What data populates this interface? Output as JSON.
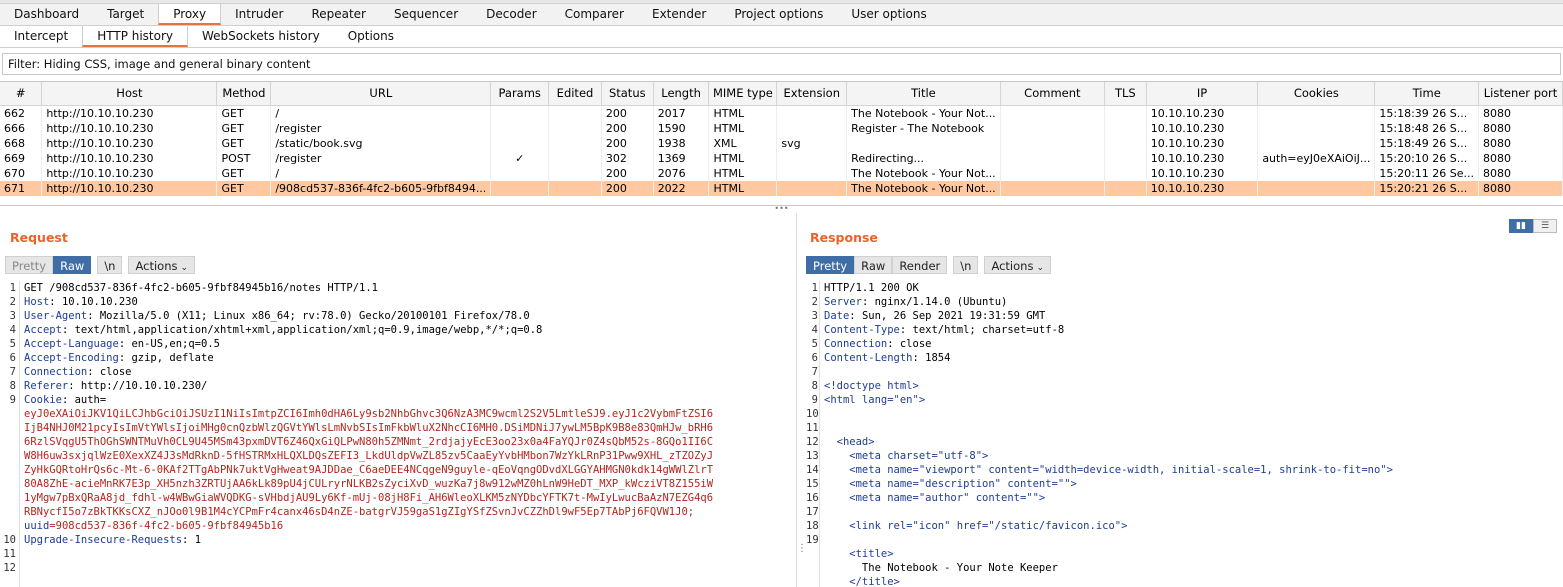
{
  "main_tabs": [
    "Dashboard",
    "Target",
    "Proxy",
    "Intruder",
    "Repeater",
    "Sequencer",
    "Decoder",
    "Comparer",
    "Extender",
    "Project options",
    "User options"
  ],
  "main_tab_active": 2,
  "sub_tabs": [
    "Intercept",
    "HTTP history",
    "WebSockets history",
    "Options"
  ],
  "sub_tab_active": 1,
  "filter_text": "Filter: Hiding CSS, image and general binary content",
  "history": {
    "columns": [
      "#",
      "Host",
      "Method",
      "URL",
      "Params",
      "Edited",
      "Status",
      "Length",
      "MIME type",
      "Extension",
      "Title",
      "Comment",
      "TLS",
      "IP",
      "Cookies",
      "Time",
      "Listener port"
    ],
    "rows": [
      [
        "662",
        "http://10.10.10.230",
        "GET",
        "/",
        "",
        "",
        "200",
        "2017",
        "HTML",
        "",
        "The Notebook - Your Not...",
        "",
        "",
        "10.10.10.230",
        "",
        "15:18:39 26 S...",
        "8080"
      ],
      [
        "666",
        "http://10.10.10.230",
        "GET",
        "/register",
        "",
        "",
        "200",
        "1590",
        "HTML",
        "",
        "Register - The Notebook",
        "",
        "",
        "10.10.10.230",
        "",
        "15:18:48 26 S...",
        "8080"
      ],
      [
        "668",
        "http://10.10.10.230",
        "GET",
        "/static/book.svg",
        "",
        "",
        "200",
        "1938",
        "XML",
        "svg",
        "",
        "",
        "",
        "10.10.10.230",
        "",
        "15:18:49 26 S...",
        "8080"
      ],
      [
        "669",
        "http://10.10.10.230",
        "POST",
        "/register",
        "✓",
        "",
        "302",
        "1369",
        "HTML",
        "",
        "Redirecting...",
        "",
        "",
        "10.10.10.230",
        "auth=eyJ0eXAiOiJ...",
        "15:20:10 26 S...",
        "8080"
      ],
      [
        "670",
        "http://10.10.10.230",
        "GET",
        "/",
        "",
        "",
        "200",
        "2076",
        "HTML",
        "",
        "The Notebook - Your Not...",
        "",
        "",
        "10.10.10.230",
        "",
        "15:20:11 26 Se...",
        "8080"
      ],
      [
        "671",
        "http://10.10.10.230",
        "GET",
        "/908cd537-836f-4fc2-b605-9fbf8494...",
        "",
        "",
        "200",
        "2022",
        "HTML",
        "",
        "The Notebook - Your Not...",
        "",
        "",
        "10.10.10.230",
        "",
        "15:20:21 26 S...",
        "8080"
      ]
    ],
    "selected_row": 5,
    "selected_color": "#ffc8a0"
  },
  "request": {
    "title": "Request",
    "buttons": {
      "pretty": "Pretty",
      "raw": "Raw",
      "newline": "\\n",
      "actions": "Actions"
    },
    "lines": [
      {
        "n": "1",
        "name": "",
        "value": "GET /908cd537-836f-4fc2-b605-9fbf84945b16/notes HTTP/1.1"
      },
      {
        "n": "2",
        "name": "Host",
        "value": ": 10.10.10.230"
      },
      {
        "n": "3",
        "name": "User-Agent",
        "value": ": Mozilla/5.0 (X11; Linux x86_64; rv:78.0) Gecko/20100101 Firefox/78.0"
      },
      {
        "n": "4",
        "name": "Accept",
        "value": ": text/html,application/xhtml+xml,application/xml;q=0.9,image/webp,*/*;q=0.8"
      },
      {
        "n": "5",
        "name": "Accept-Language",
        "value": ": en-US,en;q=0.5"
      },
      {
        "n": "6",
        "name": "Accept-Encoding",
        "value": ": gzip, deflate"
      },
      {
        "n": "7",
        "name": "Connection",
        "value": ": close"
      },
      {
        "n": "8",
        "name": "Referer",
        "value": ": http://10.10.10.230/"
      },
      {
        "n": "9",
        "name": "Cookie",
        "value": ": auth="
      }
    ],
    "cookie_lines": [
      "eyJ0eXAiOiJKV1QiLCJhbGciOiJSUzI1NiIsImtpZCI6Imh0dHA6Ly9sb2NhbGhvc3Q6NzA3MC9wcml2S2V5LmtleSJ9.eyJ1c2VybmFtZSI6",
      "IjB4NHJ0M21pcyIsImVtYWlsIjoiMHg0cnQzbWlzQGVtYWlsLmNvbSIsImFkbWluX2NhcCI6MH0.DSiMDNiJ7ywLM5BpK9B8e83QmHJw_bRH6",
      "6RzlSVqgU5ThOGhSWNTMuVh0CL9U45MSm43pxmDVT6Z46QxGiQLPwN80h5ZMNmt_2rdjajyEcE3oo23x0a4FaYQJr0Z4sQbM52s-8GQo1II6C",
      "W8H6uw3sxjqlWzE0XexXZ4J3sMdRknD-5fHSTRMxHLQXLDQsZEFI3_LkdUldpVwZL85zv5CaaEyYvbHMbon7WzYkLRnP31Pww9XHL_zTZOZyJ",
      "ZyHkGQRtoHrQs6c-Mt-6-0KAf2TTgAbPNk7uktVgHweat9AJDDae_C6aeDEE4NCqgeN9guyle-qEoVqngODvdXLGGYAHMGN0kdk14gWWlZlrT",
      "80A8ZhE-acieMnRK7E3p_XH5nzh3ZRTUjAA6kLk89pU4jCULryrNLKB2sZyciXvD_wuzKa7j8w912wMZ0hLnW9HeDT_MXP_kWcziVT8Z155iW",
      "1yMgw7pBxQRaA8jd_fdhl-w4WBwGiaWVQDKG-sVHbdjAU9Ly6Kf-mUj-08jH8Fi_AH6WleoXLKM5zNYDbcYFTK7t-MwIyLwucBaAzN7EZG4q6",
      "RBNycfI5o7zBkTKKsCXZ_nJOo0l9B1M4cYCPmFr4canx46sD4nZE-batgrVJ59gaS1gZIgYSfZSvnJvCZZhDl9wF5Ep7TAbPj6FQVW1J0;"
    ],
    "uuid_name": "uuid",
    "uuid_value": "=908cd537-836f-4fc2-b605-9fbf84945b16",
    "line10_n": "10",
    "line10_name": "Upgrade-Insecure-Requests",
    "line10_value": ": 1",
    "line11_n": "11",
    "line12_n": "12"
  },
  "response": {
    "title": "Response",
    "buttons": {
      "pretty": "Pretty",
      "raw": "Raw",
      "render": "Render",
      "newline": "\\n",
      "actions": "Actions"
    },
    "lines": [
      {
        "n": "1",
        "name": "",
        "value": "HTTP/1.1 200 OK"
      },
      {
        "n": "2",
        "name": "Server",
        "value": ": nginx/1.14.0 (Ubuntu)"
      },
      {
        "n": "3",
        "name": "Date",
        "value": ": Sun, 26 Sep 2021 19:31:59 GMT"
      },
      {
        "n": "4",
        "name": "Content-Type",
        "value": ": text/html; charset=utf-8"
      },
      {
        "n": "5",
        "name": "Connection",
        "value": ": close"
      },
      {
        "n": "6",
        "name": "Content-Length",
        "value": ": 1854"
      },
      {
        "n": "7",
        "name": "",
        "value": ""
      },
      {
        "n": "8",
        "name": "",
        "value": "<!doctype html>"
      },
      {
        "n": "9",
        "name": "",
        "value": "<html lang=\"en\">"
      },
      {
        "n": "10",
        "name": "",
        "value": ""
      },
      {
        "n": "11",
        "name": "",
        "value": ""
      },
      {
        "n": "12",
        "name": "",
        "value": "  <head>"
      },
      {
        "n": "13",
        "name": "",
        "value": "    <meta charset=\"utf-8\">"
      },
      {
        "n": "14",
        "name": "",
        "value": "    <meta name=\"viewport\" content=\"width=device-width, initial-scale=1, shrink-to-fit=no\">"
      },
      {
        "n": "15",
        "name": "",
        "value": "    <meta name=\"description\" content=\"\">"
      },
      {
        "n": "16",
        "name": "",
        "value": "    <meta name=\"author\" content=\"\">"
      },
      {
        "n": "17",
        "name": "",
        "value": ""
      },
      {
        "n": "18",
        "name": "",
        "value": "    <link rel=\"icon\" href=\"/static/favicon.ico\">"
      },
      {
        "n": "19",
        "name": "",
        "value": ""
      },
      {
        "n": "",
        "name": "",
        "value": "    <title>"
      },
      {
        "n": "",
        "name": "",
        "value": "      The Notebook - Your Note Keeper"
      },
      {
        "n": "",
        "name": "",
        "value": "    </title>"
      },
      {
        "n": "20",
        "name": "",
        "value": ""
      }
    ]
  },
  "view_toggle_icons": [
    "split-view-icon",
    "stacked-view-icon"
  ],
  "accent_color": "#e8632e"
}
